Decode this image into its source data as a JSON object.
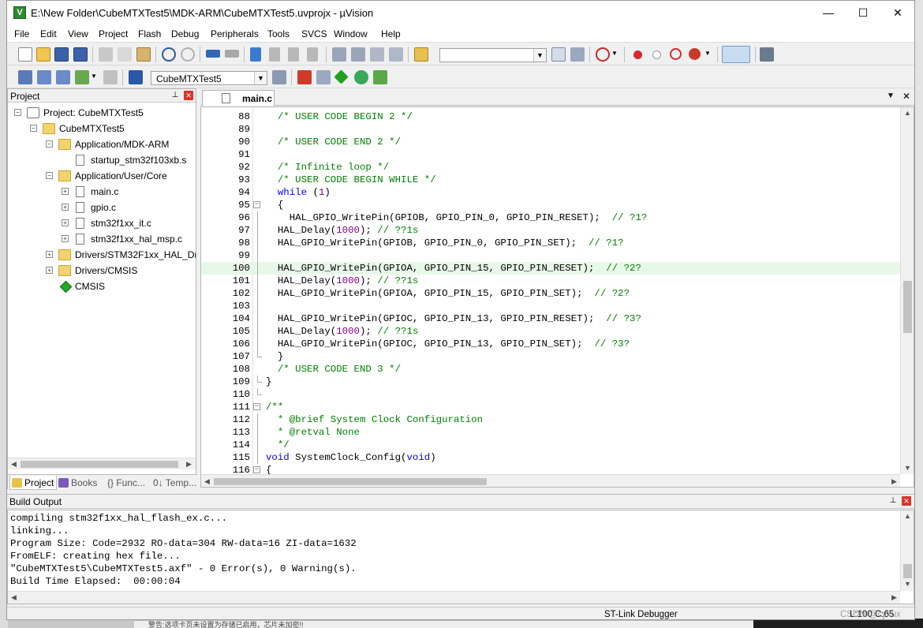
{
  "window": {
    "title": "E:\\New Folder\\CubeMTXTest5\\MDK-ARM\\CubeMTXTest5.uvprojx - µVision",
    "minimize": "—",
    "maximize": "☐",
    "close": "✕"
  },
  "menu": [
    "File",
    "Edit",
    "View",
    "Project",
    "Flash",
    "Debug",
    "Peripherals",
    "Tools",
    "SVCS",
    "Window",
    "Help"
  ],
  "toolbar2": {
    "target": "CubeMTXTest5"
  },
  "project_panel": {
    "title": "Project",
    "tree": [
      {
        "label": "Project: CubeMTXTest5",
        "icon": "project-root-icon"
      },
      {
        "label": "CubeMTXTest5",
        "icon": "target-folder-icon"
      },
      {
        "label": "Application/MDK-ARM",
        "icon": "folder-icon"
      },
      {
        "label": "startup_stm32f103xb.s",
        "icon": "file-icon"
      },
      {
        "label": "Application/User/Core",
        "icon": "folder-icon"
      },
      {
        "label": "main.c",
        "icon": "file-icon"
      },
      {
        "label": "gpio.c",
        "icon": "file-icon"
      },
      {
        "label": "stm32f1xx_it.c",
        "icon": "file-icon"
      },
      {
        "label": "stm32f1xx_hal_msp.c",
        "icon": "file-icon"
      },
      {
        "label": "Drivers/STM32F1xx_HAL_Driv",
        "icon": "folder-icon"
      },
      {
        "label": "Drivers/CMSIS",
        "icon": "folder-icon"
      },
      {
        "label": "CMSIS",
        "icon": "cmsis-diamond-icon"
      }
    ],
    "tabs": [
      "Project",
      "Books",
      "{} Func...",
      "0↓ Temp..."
    ]
  },
  "editor": {
    "tab": "main.c",
    "lines": [
      {
        "n": "88",
        "t": "  /* USER CODE BEGIN 2 */"
      },
      {
        "n": "89",
        "t": ""
      },
      {
        "n": "90",
        "t": "  /* USER CODE END 2 */"
      },
      {
        "n": "91",
        "t": ""
      },
      {
        "n": "92",
        "t": "  /* Infinite loop */"
      },
      {
        "n": "93",
        "t": "  /* USER CODE BEGIN WHILE */"
      },
      {
        "n": "94",
        "t": "  while (1)"
      },
      {
        "n": "95",
        "t": "  {"
      },
      {
        "n": "96",
        "t": "    HAL_GPIO_WritePin(GPIOB, GPIO_PIN_0, GPIO_PIN_RESET);  // ?1?"
      },
      {
        "n": "97",
        "t": "  HAL_Delay(1000); // ??1s"
      },
      {
        "n": "98",
        "t": "  HAL_GPIO_WritePin(GPIOB, GPIO_PIN_0, GPIO_PIN_SET);  // ?1?"
      },
      {
        "n": "99",
        "t": ""
      },
      {
        "n": "100",
        "t": "  HAL_GPIO_WritePin(GPIOA, GPIO_PIN_15, GPIO_PIN_RESET);  // ?2?"
      },
      {
        "n": "101",
        "t": "  HAL_Delay(1000); // ??1s"
      },
      {
        "n": "102",
        "t": "  HAL_GPIO_WritePin(GPIOA, GPIO_PIN_15, GPIO_PIN_SET);  // ?2?"
      },
      {
        "n": "103",
        "t": ""
      },
      {
        "n": "104",
        "t": "  HAL_GPIO_WritePin(GPIOC, GPIO_PIN_13, GPIO_PIN_RESET);  // ?3?"
      },
      {
        "n": "105",
        "t": "  HAL_Delay(1000); // ??1s"
      },
      {
        "n": "106",
        "t": "  HAL_GPIO_WritePin(GPIOC, GPIO_PIN_13, GPIO_PIN_SET);  // ?3?"
      },
      {
        "n": "107",
        "t": "  }"
      },
      {
        "n": "108",
        "t": "  /* USER CODE END 3 */"
      },
      {
        "n": "109",
        "t": "}"
      },
      {
        "n": "110",
        "t": ""
      },
      {
        "n": "111",
        "t": "/**"
      },
      {
        "n": "112",
        "t": "  * @brief System Clock Configuration"
      },
      {
        "n": "113",
        "t": "  * @retval None"
      },
      {
        "n": "114",
        "t": "  */"
      },
      {
        "n": "115",
        "t": "void SystemClock_Config(void)"
      },
      {
        "n": "116",
        "t": "{"
      }
    ]
  },
  "build_output": {
    "title": "Build Output",
    "lines": [
      "compiling stm32f1xx_hal_flash_ex.c...",
      "linking...",
      "Program Size: Code=2932 RO-data=304 RW-data=16 ZI-data=1632",
      "FromELF: creating hex file...",
      "\"CubeMTXTest5\\CubeMTXTest5.axf\" - 0 Error(s), 0 Warning(s).",
      "Build Time Elapsed:  00:00:04"
    ]
  },
  "status": {
    "debugger": "ST-Link Debugger",
    "position": "L:100 C:65",
    "watermark": "CSDN @cyxux"
  },
  "background": {
    "bottom_text": "警告:选项卡页未设置为存储已启用，芯片未加密!!"
  }
}
